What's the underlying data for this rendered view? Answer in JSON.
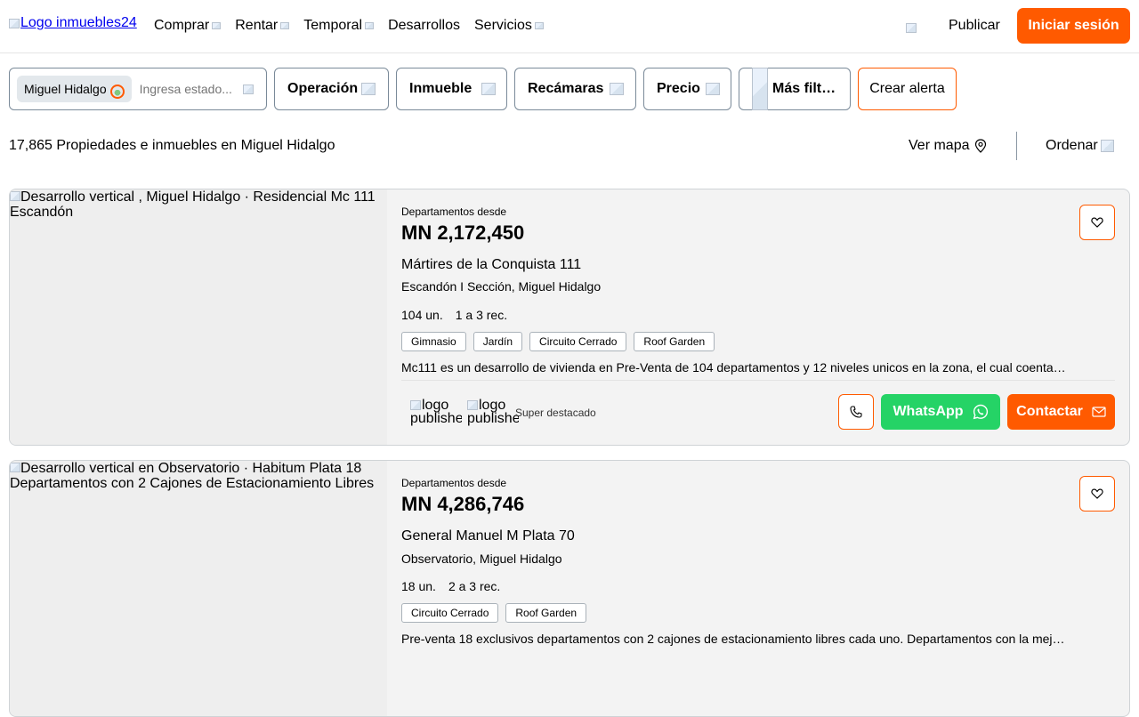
{
  "header": {
    "logo_alt": "Logo inmuebles24",
    "nav": [
      {
        "label": "Comprar",
        "has_dropdown": true
      },
      {
        "label": "Rentar",
        "has_dropdown": true
      },
      {
        "label": "Temporal",
        "has_dropdown": true
      },
      {
        "label": "Desarrollos",
        "has_dropdown": false
      },
      {
        "label": "Servicios",
        "has_dropdown": true
      }
    ],
    "publish_label": "Publicar",
    "login_label": "Iniciar sesión"
  },
  "filters": {
    "location_chip": "Miguel Hidalgo",
    "search_placeholder": "Ingresa estado...",
    "operation_label": "Operación",
    "property_label": "Inmueble",
    "bedrooms_label": "Recámaras",
    "price_label": "Precio",
    "more_filters_label": "Más filt…",
    "create_alert_label": "Crear alerta"
  },
  "results": {
    "count_text": "17,865 Propiedades e inmuebles en Miguel Hidalgo",
    "map_label": "Ver mapa",
    "sort_label": "Ordenar"
  },
  "listings": [
    {
      "image_alt": "Desarrollo vertical , Miguel Hidalgo · Residencial Mc 111 Escandón",
      "type": "Departamentos desde",
      "price": "MN 2,172,450",
      "street": "Mártires de la Conquista 111",
      "neighborhood": "Escandón I Sección, Miguel Hidalgo",
      "units": "104 un.",
      "bedrooms": "1 a 3 rec.",
      "amenities": [
        "Gimnasio",
        "Jardín",
        "Circuito Cerrado",
        "Roof Garden"
      ],
      "description": "Mc111 es un desarrollo de vivienda en Pre-Venta de 104 departamentos y 12 niveles unicos en la zona, el cual coenta…",
      "publisher_logo_alt_1": "logo publisher",
      "publisher_logo_alt_2": "logo publisher",
      "badge": "Super destacado",
      "whatsapp_label": "WhatsApp",
      "contact_label": "Contactar"
    },
    {
      "image_alt": "Desarrollo vertical en Observatorio · Habitum Plata 18 Departamentos con 2 Cajones de Estacionamiento Libres",
      "type": "Departamentos desde",
      "price": "MN 4,286,746",
      "street": "General Manuel M Plata 70",
      "neighborhood": "Observatorio, Miguel Hidalgo",
      "units": "18 un.",
      "bedrooms": "2 a 3 rec.",
      "amenities": [
        "Circuito Cerrado",
        "Roof Garden"
      ],
      "description": "Pre-venta 18 exclusivos departamentos con 2 cajones de estacionamiento libres cada uno. Departamentos con la mej…"
    }
  ],
  "colors": {
    "accent": "#ff5a00",
    "whatsapp": "#25d366",
    "card_bg": "#f3f3f3",
    "border": "#7a8a99"
  }
}
